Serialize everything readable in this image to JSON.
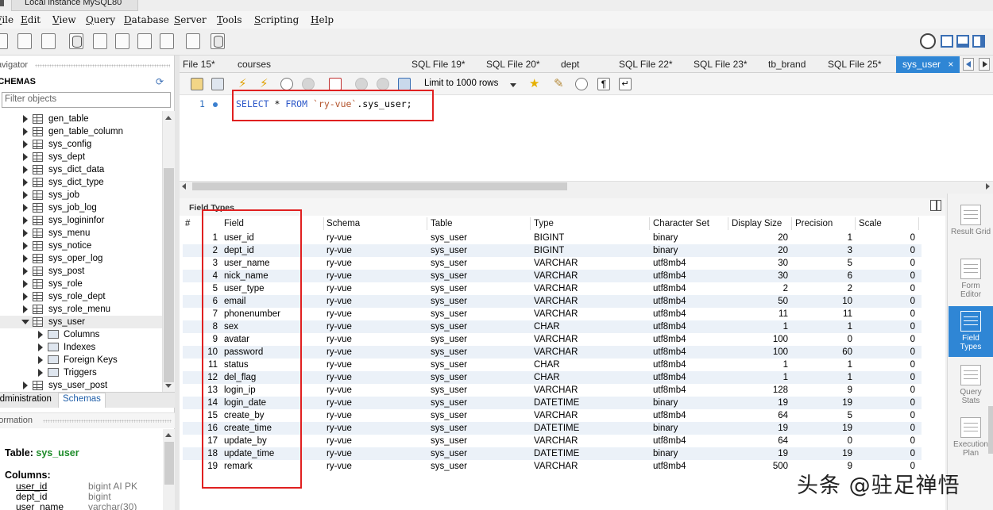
{
  "window": {
    "title": "Local instance MySQL80"
  },
  "menu": [
    "File",
    "Edit",
    "View",
    "Query",
    "Database",
    "Server",
    "Tools",
    "Scripting",
    "Help"
  ],
  "navigator": {
    "header": "Navigator",
    "schemas_title": "SCHEMAS",
    "filter_placeholder": "Filter objects",
    "tables": [
      "gen_table",
      "gen_table_column",
      "sys_config",
      "sys_dept",
      "sys_dict_data",
      "sys_dict_type",
      "sys_job",
      "sys_job_log",
      "sys_logininfor",
      "sys_menu",
      "sys_notice",
      "sys_oper_log",
      "sys_post",
      "sys_role",
      "sys_role_dept",
      "sys_role_menu",
      "sys_user"
    ],
    "sub_items": [
      "Columns",
      "Indexes",
      "Foreign Keys",
      "Triggers"
    ],
    "after_table": "sys_user_post",
    "tabs": [
      "Administration",
      "Schemas"
    ]
  },
  "information": {
    "header": "Information",
    "table_label": "Table:",
    "table_name": "sys_user",
    "columns_label": "Columns:",
    "columns": [
      {
        "name": "user_id",
        "type": "bigint AI PK"
      },
      {
        "name": "dept_id",
        "type": "bigint"
      },
      {
        "name": "user_name",
        "type": "varchar(30)"
      }
    ]
  },
  "editor_tabs": [
    "File 15*",
    "courses",
    "SQL File 19*",
    "SQL File 20*",
    "dept",
    "SQL File 22*",
    "SQL File 23*",
    "tb_brand",
    "SQL File 25*",
    "sys_user"
  ],
  "active_tab_close": "×",
  "query_toolbar": {
    "limit": "Limit to 1000 rows"
  },
  "editor": {
    "line_number": "1",
    "kw_select": "SELECT",
    "star": " * ",
    "kw_from": "FROM",
    "schema": "`ry-vue`",
    "rest": ".sys_user;"
  },
  "result": {
    "title": "Field Types",
    "columns": [
      "#",
      "Field",
      "Schema",
      "Table",
      "Type",
      "Character Set",
      "Display Size",
      "Precision",
      "Scale"
    ],
    "rows": [
      [
        "1",
        "user_id",
        "ry-vue",
        "sys_user",
        "BIGINT",
        "binary",
        "20",
        "1",
        "0"
      ],
      [
        "2",
        "dept_id",
        "ry-vue",
        "sys_user",
        "BIGINT",
        "binary",
        "20",
        "3",
        "0"
      ],
      [
        "3",
        "user_name",
        "ry-vue",
        "sys_user",
        "VARCHAR",
        "utf8mb4",
        "30",
        "5",
        "0"
      ],
      [
        "4",
        "nick_name",
        "ry-vue",
        "sys_user",
        "VARCHAR",
        "utf8mb4",
        "30",
        "6",
        "0"
      ],
      [
        "5",
        "user_type",
        "ry-vue",
        "sys_user",
        "VARCHAR",
        "utf8mb4",
        "2",
        "2",
        "0"
      ],
      [
        "6",
        "email",
        "ry-vue",
        "sys_user",
        "VARCHAR",
        "utf8mb4",
        "50",
        "10",
        "0"
      ],
      [
        "7",
        "phonenumber",
        "ry-vue",
        "sys_user",
        "VARCHAR",
        "utf8mb4",
        "11",
        "11",
        "0"
      ],
      [
        "8",
        "sex",
        "ry-vue",
        "sys_user",
        "CHAR",
        "utf8mb4",
        "1",
        "1",
        "0"
      ],
      [
        "9",
        "avatar",
        "ry-vue",
        "sys_user",
        "VARCHAR",
        "utf8mb4",
        "100",
        "0",
        "0"
      ],
      [
        "10",
        "password",
        "ry-vue",
        "sys_user",
        "VARCHAR",
        "utf8mb4",
        "100",
        "60",
        "0"
      ],
      [
        "11",
        "status",
        "ry-vue",
        "sys_user",
        "CHAR",
        "utf8mb4",
        "1",
        "1",
        "0"
      ],
      [
        "12",
        "del_flag",
        "ry-vue",
        "sys_user",
        "CHAR",
        "utf8mb4",
        "1",
        "1",
        "0"
      ],
      [
        "13",
        "login_ip",
        "ry-vue",
        "sys_user",
        "VARCHAR",
        "utf8mb4",
        "128",
        "9",
        "0"
      ],
      [
        "14",
        "login_date",
        "ry-vue",
        "sys_user",
        "DATETIME",
        "binary",
        "19",
        "19",
        "0"
      ],
      [
        "15",
        "create_by",
        "ry-vue",
        "sys_user",
        "VARCHAR",
        "utf8mb4",
        "64",
        "5",
        "0"
      ],
      [
        "16",
        "create_time",
        "ry-vue",
        "sys_user",
        "DATETIME",
        "binary",
        "19",
        "19",
        "0"
      ],
      [
        "17",
        "update_by",
        "ry-vue",
        "sys_user",
        "VARCHAR",
        "utf8mb4",
        "64",
        "0",
        "0"
      ],
      [
        "18",
        "update_time",
        "ry-vue",
        "sys_user",
        "DATETIME",
        "binary",
        "19",
        "19",
        "0"
      ],
      [
        "19",
        "remark",
        "ry-vue",
        "sys_user",
        "VARCHAR",
        "utf8mb4",
        "500",
        "9",
        "0"
      ]
    ]
  },
  "side_panel": [
    {
      "label": "Result Grid",
      "active": false
    },
    {
      "label": "Form Editor",
      "active": false
    },
    {
      "label": "Field Types",
      "active": true
    },
    {
      "label": "Query Stats",
      "active": false
    },
    {
      "label": "Execution Plan",
      "active": false
    }
  ],
  "watermark": "头条 @驻足禅悟",
  "colors": {
    "accent": "#2f86d5",
    "highlight": "#e02020",
    "keyword": "#2e59c9",
    "string": "#b3532b"
  }
}
